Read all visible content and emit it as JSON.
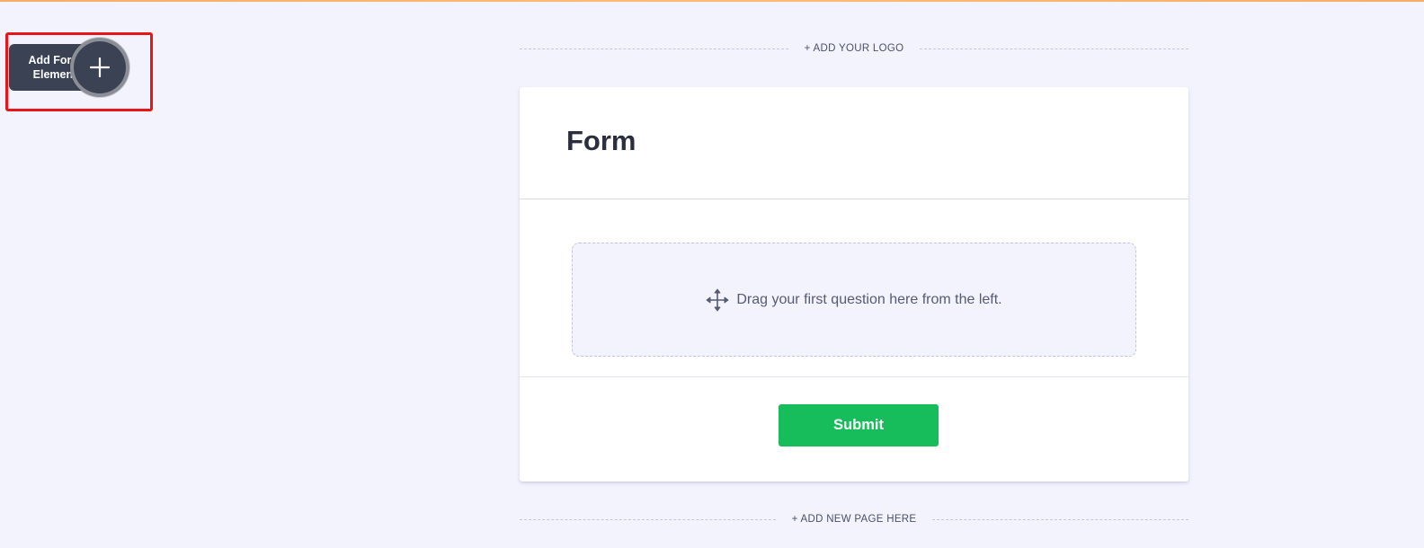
{
  "toolbar": {
    "add_element_label": "Add Form Element",
    "add_element_icon": "plus-icon"
  },
  "canvas": {
    "add_logo_label": "+ ADD YOUR LOGO",
    "add_page_label": "+ ADD NEW PAGE HERE"
  },
  "form": {
    "title": "Form",
    "drop_zone_text": "Drag your first question here from the left.",
    "drop_zone_icon": "move-arrows-icon",
    "submit_label": "Submit"
  },
  "colors": {
    "background": "#f3f3fe",
    "submit": "#18bd5b",
    "widget_dark": "#3a4254",
    "highlight": "#e8151b",
    "accent_top": "#f7a24a"
  }
}
